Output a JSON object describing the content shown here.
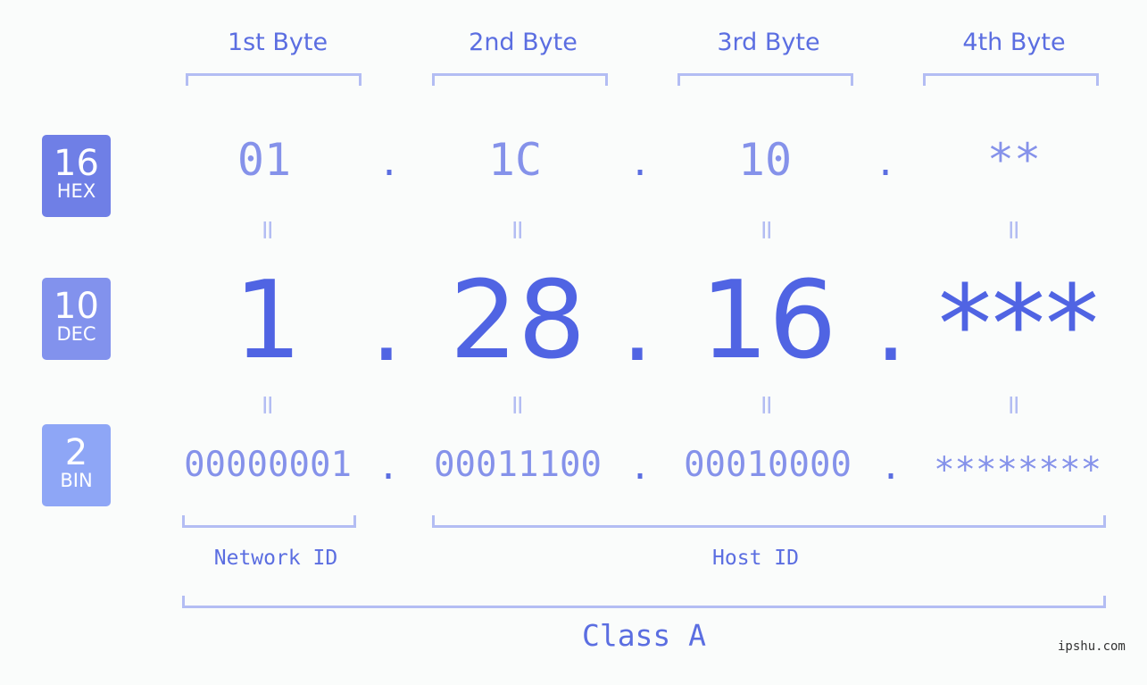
{
  "header": {
    "bytes": [
      "1st Byte",
      "2nd Byte",
      "3rd Byte",
      "4th Byte"
    ]
  },
  "badges": {
    "hex": {
      "num": "16",
      "label": "HEX",
      "color": "#6f7fe6"
    },
    "dec": {
      "num": "10",
      "label": "DEC",
      "color": "#8292ed"
    },
    "bin": {
      "num": "2",
      "label": "BIN",
      "color": "#8ea6f6"
    }
  },
  "rows": {
    "hex": [
      "01",
      "1C",
      "10",
      "**"
    ],
    "dec": [
      "1",
      "28",
      "16",
      "***"
    ],
    "bin": [
      "00000001",
      "00011100",
      "00010000",
      "********"
    ],
    "separator": ".",
    "equals": "="
  },
  "ids": {
    "network": "Network ID",
    "host": "Host ID"
  },
  "class_label": "Class A",
  "watermark": "ipshu.com"
}
